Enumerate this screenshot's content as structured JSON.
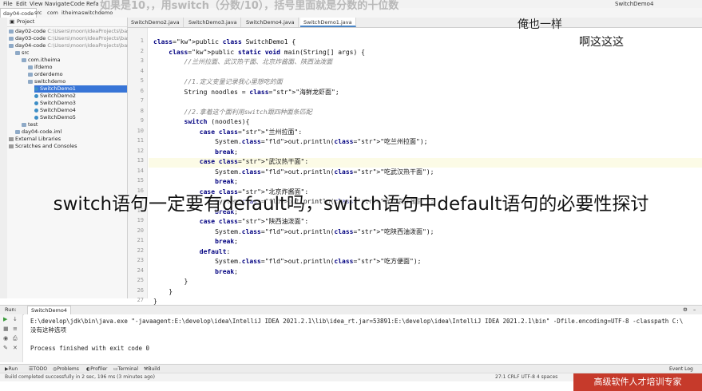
{
  "menu": {
    "items": [
      "File",
      "Edit",
      "View",
      "Navigate",
      "Code",
      "Refa"
    ],
    "breadcrumbs": [
      "day04-code",
      "src",
      "com",
      "itheima",
      "switchdemo"
    ],
    "run_config": "SwitchDemo4"
  },
  "project": {
    "header": "Project",
    "tree": [
      {
        "label": "day02-code",
        "path": "C:\\Users\\moon\\IdeaProjects\\basic-c",
        "indent": 0,
        "icon": "folder"
      },
      {
        "label": "day03-code",
        "path": "C:\\Users\\moon\\IdeaProjects\\basic-c",
        "indent": 0,
        "icon": "folder"
      },
      {
        "label": "day04-code",
        "path": "C:\\Users\\moon\\IdeaProjects\\basic-c",
        "indent": 0,
        "icon": "folder"
      },
      {
        "label": "src",
        "path": "",
        "indent": 1,
        "icon": "folder"
      },
      {
        "label": "com.itheima",
        "path": "",
        "indent": 2,
        "icon": "folder"
      },
      {
        "label": "ifdemo",
        "path": "",
        "indent": 3,
        "icon": "folder"
      },
      {
        "label": "orderdemo",
        "path": "",
        "indent": 3,
        "icon": "folder"
      },
      {
        "label": "switchdemo",
        "path": "",
        "indent": 3,
        "icon": "folder"
      },
      {
        "label": "SwitchDemo1",
        "path": "",
        "indent": 4,
        "icon": "java",
        "selected": true
      },
      {
        "label": "SwitchDemo2",
        "path": "",
        "indent": 4,
        "icon": "java"
      },
      {
        "label": "SwitchDemo3",
        "path": "",
        "indent": 4,
        "icon": "java"
      },
      {
        "label": "SwitchDemo4",
        "path": "",
        "indent": 4,
        "icon": "java"
      },
      {
        "label": "SwitchDemo5",
        "path": "",
        "indent": 4,
        "icon": "java"
      },
      {
        "label": "test",
        "path": "",
        "indent": 2,
        "icon": "folder"
      },
      {
        "label": "day04-code.iml",
        "path": "",
        "indent": 1,
        "icon": "file"
      },
      {
        "label": "External Libraries",
        "path": "",
        "indent": 0,
        "icon": "lib"
      },
      {
        "label": "Scratches and Consoles",
        "path": "",
        "indent": 0,
        "icon": "lib"
      }
    ]
  },
  "editor": {
    "tabs": [
      "SwitchDemo2.java",
      "SwitchDemo3.java",
      "SwitchDemo4.java",
      "SwitchDemo1.java"
    ],
    "active_tab": 3,
    "line_numbers": [
      "1",
      "2",
      "3",
      "4",
      "5",
      "6",
      "7",
      "8",
      "9",
      "10",
      "11",
      "12",
      "13",
      "14",
      "15",
      "16",
      "17",
      "18",
      "19",
      "20",
      "21",
      "22",
      "23",
      "24",
      "25",
      "26",
      "27"
    ],
    "lines": [
      "public class SwitchDemo1 {",
      "    public static void main(String[] args) {",
      "        //兰州拉面、武汉热干面、北京炸酱面、陕西油泼面",
      "",
      "        //1.定义变量记录我心里想吃的面",
      "        String noodles = \"海鲜龙虾面\";",
      "",
      "        //2.拿着这个面利用switch跟四种面条匹配",
      "        switch (noodles){",
      "            case \"兰州拉面\":",
      "                System.out.println(\"吃兰州拉面\");",
      "                break;",
      "            case \"武汉热干面\":",
      "                System.out.println(\"吃武汉热干面\");",
      "                break;",
      "            case \"北京炸酱面\":",
      "                System.out.println(\"吃北京炸酱面\");",
      "                break;",
      "            case \"陕西油泼面\":",
      "                System.out.println(\"吃陕西油泼面\");",
      "                break;",
      "            default:",
      "                System.out.println(\"吃方便面\");",
      "                break;",
      "        }",
      "    }",
      "}"
    ]
  },
  "overlay": {
    "main_subtitle": "switch语句一定要有default吗，switch语句中default语句的必要性探讨",
    "top_caption": "如果是10，，用switch（分数/10），括号里面就是分数的十位数",
    "right_caption_1": "俺也一样",
    "right_caption_2": "啊这这这"
  },
  "run": {
    "label": "Run:",
    "config": "SwitchDemo4",
    "console": [
      "E:\\develop\\jdk\\bin\\java.exe \"-javaagent:E:\\develop\\idea\\IntelliJ IDEA 2021.2.1\\lib\\idea_rt.jar=53891:E:\\develop\\idea\\IntelliJ IDEA 2021.2.1\\bin\" -Dfile.encoding=UTF-8 -classpath C:\\",
      "没有这种选项",
      "",
      "Process finished with exit code 0"
    ]
  },
  "bottom_tools": [
    "Run",
    "TODO",
    "Problems",
    "Profiler",
    "Terminal",
    "Build",
    "Event Log"
  ],
  "status": {
    "message": "Build completed successfully in 2 sec, 196 ms (3 minutes ago)",
    "right": "27:1  CRLF  UTF-8  4 spaces"
  },
  "watermark": "高级软件人才培训专家",
  "colors": {
    "keyword": "#000080",
    "comment": "#808080",
    "string": "#067d17",
    "selection": "#3875d7",
    "watermark_bg": "#c63a2b"
  }
}
